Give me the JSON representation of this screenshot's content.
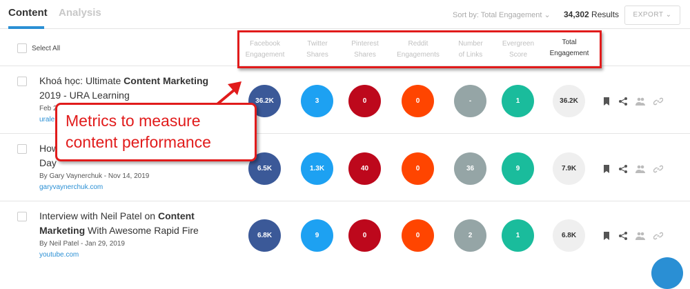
{
  "tabs": [
    {
      "label": "Content"
    },
    {
      "label": "Analysis"
    }
  ],
  "toolbar": {
    "sort_label": "Sort by: Total Engagement",
    "results_count": "34,302",
    "results_word": "Results",
    "export_label": "EXPORT"
  },
  "header": {
    "select_all": "Select All",
    "columns": [
      {
        "line1": "Facebook",
        "line2": "Engagement"
      },
      {
        "line1": "Twitter",
        "line2": "Shares"
      },
      {
        "line1": "Pinterest",
        "line2": "Shares"
      },
      {
        "line1": "Reddit",
        "line2": "Engagements"
      },
      {
        "line1": "Number",
        "line2": "of Links"
      },
      {
        "line1": "Evergreen",
        "line2": "Score"
      },
      {
        "line1": "Total",
        "line2": "Engagement"
      }
    ]
  },
  "rows": [
    {
      "title_plain_1": "Khoá học: Ultimate ",
      "title_bold_1": "Content Marketing",
      "title_plain_2": " 2019 - URA Learning",
      "meta": "Feb 2",
      "domain": "urale",
      "metrics": [
        "36.2K",
        "3",
        "0",
        "0",
        "-",
        "1",
        "36.2K"
      ]
    },
    {
      "title_plain_1": "How",
      "title_bold_1": "",
      "title_plain_2": "Day",
      "meta": "By Gary Vaynerchuk - Nov 14, 2019",
      "domain": "garyvaynerchuk.com",
      "metrics": [
        "6.5K",
        "1.3K",
        "40",
        "0",
        "36",
        "9",
        "7.9K"
      ]
    },
    {
      "title_plain_1": "Interview with Neil Patel on ",
      "title_bold_1": "Content Marketing",
      "title_plain_2": " With Awesome Rapid Fire",
      "meta": "By Neil Patel - Jan 29, 2019",
      "domain": "youtube.com",
      "metrics": [
        "6.8K",
        "9",
        "0",
        "0",
        "2",
        "1",
        "6.8K"
      ]
    }
  ],
  "callout": {
    "line1": "Metrics to measure",
    "line2": "content performance"
  },
  "colors": {
    "facebook": "#3b5998",
    "twitter": "#1da1f2",
    "pinterest": "#bd081c",
    "reddit": "#ff4500",
    "links": "#95a5a6",
    "evergreen": "#1abc9c",
    "accent": "#2a8fd4",
    "highlight": "#e11b1b"
  }
}
